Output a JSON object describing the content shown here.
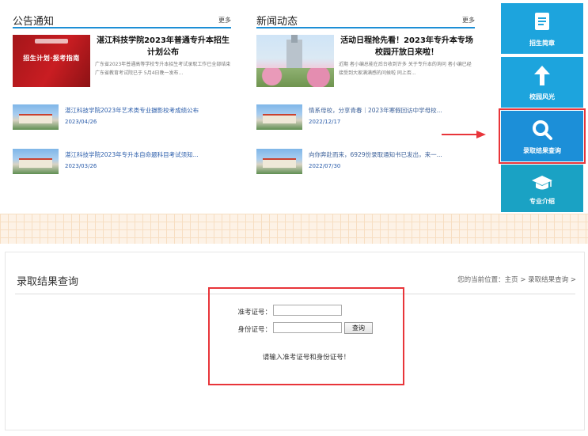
{
  "notice": {
    "title": "公告通知",
    "more": "更多",
    "feature": {
      "image_text": "招生计划·报考指南",
      "title": "湛江科技学院2023年普通专升本招生计划公布",
      "excerpt": "广东省2023年普通高等学校专升本招生考试录取工作已全部结束 广东省教育考试院已于 5月4日晚一发布..."
    },
    "items": [
      {
        "title": "湛江科技学院2023年艺术类专业摄影校考成绩公布",
        "date": "2023/04/26"
      },
      {
        "title": "湛江科技学院2023年专升本自命题科目考试须知...",
        "date": "2023/03/26"
      }
    ]
  },
  "news": {
    "title": "新闻动态",
    "more": "更多",
    "feature": {
      "title": "活动日程抢先看！2023年专升本专场校园开放日来啦！",
      "excerpt": "近期 者小编总能在后台收到许多 关于专升本的询问 者小编已经接受到大家满满感的问候啦 同上否..."
    },
    "items": [
      {
        "title": "情系母校，分享青春｜2023年寒假回访中学母校...",
        "date": "2022/12/17"
      },
      {
        "title": "向你奔赴而来，6929份录取通知书已发出，来一...",
        "date": "2022/07/30"
      }
    ]
  },
  "tiles": [
    {
      "label": "招生简章",
      "icon": "document-icon"
    },
    {
      "label": "校园风光",
      "icon": "arrow-up-icon"
    },
    {
      "label": "录取结果查询",
      "icon": "search-icon"
    },
    {
      "label": "专业介绍",
      "icon": "graduation-cap-icon"
    }
  ],
  "query": {
    "title": "录取结果查询",
    "breadcrumb": "您的当前位置：主页 > 录取结果查询 >",
    "exam_label": "准考证号：",
    "exam_value": "",
    "id_label": "身份证号：",
    "id_value": "",
    "submit": "查询",
    "hint": "请输入准考证号和身份证号！"
  },
  "colors": {
    "accent": "#1d8fd6",
    "tile": "#1da4dd",
    "highlight": "#e8353a"
  }
}
